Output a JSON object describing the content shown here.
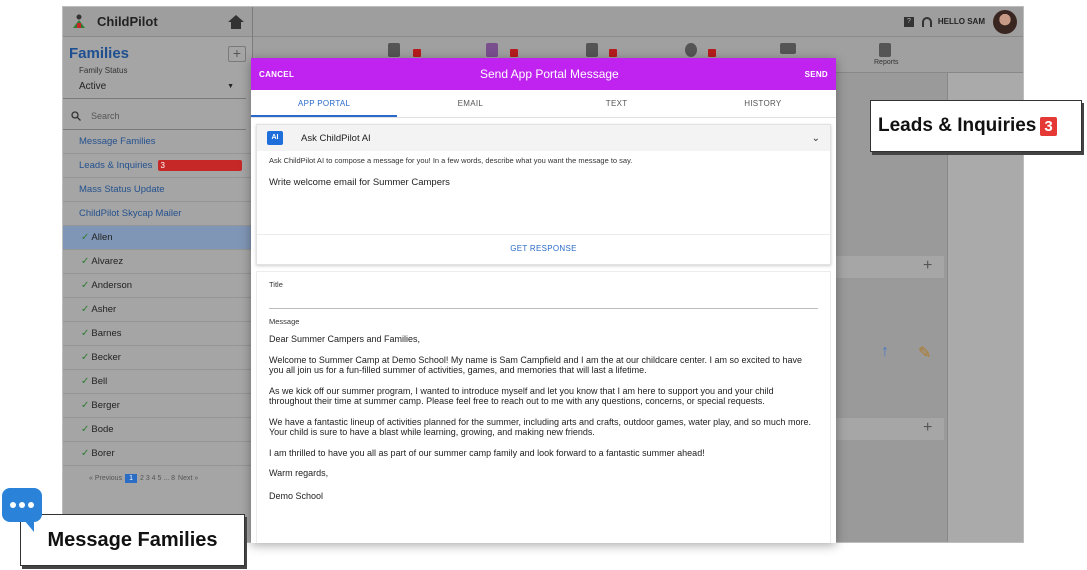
{
  "app": {
    "name": "ChildPilot",
    "greeting": "HELLO SAM"
  },
  "sidebar": {
    "section_title": "Families",
    "status_label": "Family Status",
    "status_value": "Active",
    "search_placeholder": "Search",
    "nav": [
      {
        "label": "Message Families"
      },
      {
        "label": "Leads & Inquiries",
        "badge": "3"
      },
      {
        "label": "Mass Status Update"
      },
      {
        "label": "ChildPilot Skycap Mailer"
      }
    ],
    "families": [
      "Allen",
      "Alvarez",
      "Anderson",
      "Asher",
      "Barnes",
      "Becker",
      "Bell",
      "Berger",
      "Bode",
      "Borer"
    ],
    "pager": {
      "prev": "« Previous",
      "current": "1",
      "pages": "2 3 4 5 ... 8",
      "next": "Next »"
    }
  },
  "toolbar": {
    "badges": [
      "0",
      "0",
      "0",
      "0"
    ],
    "reports_label": "Reports"
  },
  "modal": {
    "cancel": "CANCEL",
    "title": "Send App Portal Message",
    "send": "SEND",
    "tabs": [
      "APP PORTAL",
      "EMAIL",
      "TEXT",
      "HISTORY"
    ],
    "ai": {
      "icon_text": "AI",
      "title": "Ask ChildPilot AI",
      "hint": "Ask ChildPilot AI to compose a message for you! In a few words, describe what you want the message to say.",
      "input": "Write welcome email for Summer Campers",
      "action": "GET RESPONSE"
    },
    "form": {
      "title_label": "Title",
      "message_label": "Message",
      "paragraphs": [
        "Dear Summer Campers and Families,",
        "Welcome to Summer Camp at Demo School! My name is Sam Campfield and I am the  at our childcare center. I am so excited to have you all join us for a fun-filled summer of activities, games, and memories that will last a lifetime.",
        "As we kick off our summer program, I wanted to introduce myself and let you know that I am here to support you and your child throughout their time at summer camp. Please feel free to reach out to me with any questions, concerns, or special requests.",
        "We have a fantastic lineup of activities planned for the summer, including arts and crafts, outdoor games, water play, and so much more. Your child is sure to have a blast while learning, growing, and making new friends.",
        "I am thrilled to have you all as part of our summer camp family and look forward to a fantastic summer ahead!",
        "Warm regards,",
        "",
        "Demo School"
      ]
    }
  },
  "callouts": {
    "leads_text": "Leads & Inquiries",
    "leads_count": "3",
    "message_text": "Message Families"
  },
  "colors": {
    "modal_header": "#c023f0",
    "accent": "#2a6bc9",
    "badge": "#e53935"
  }
}
